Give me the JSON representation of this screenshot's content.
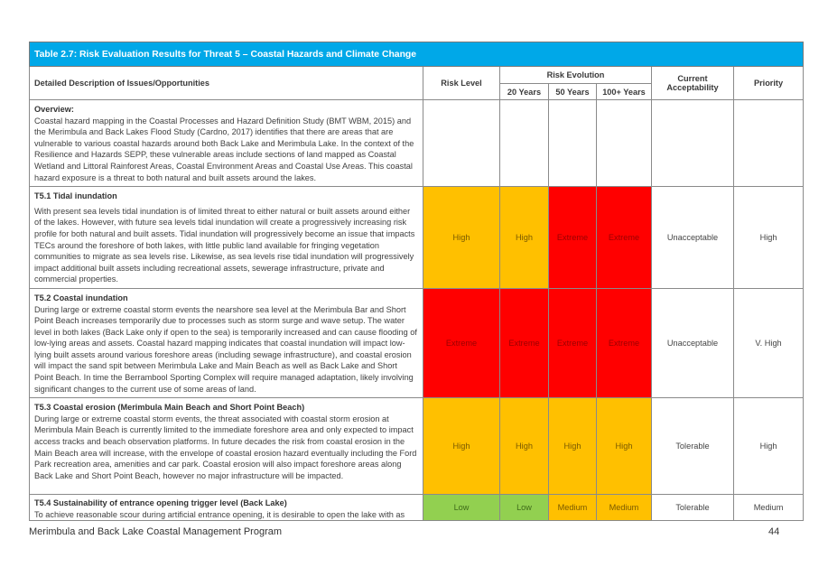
{
  "table": {
    "title": "Table 2.7: Risk Evaluation Results for Threat 5 – Coastal Hazards and Climate Change",
    "headers": {
      "description": "Detailed Description of Issues/Opportunities",
      "risk_level": "Risk Level",
      "risk_evolution": "Risk Evolution",
      "years_20": "20 Years",
      "years_50": "50 Years",
      "years_100": "100+ Years",
      "current_acceptability": "Current Acceptability",
      "priority": "Priority"
    },
    "overview": {
      "heading": "Overview:",
      "text": "Coastal hazard mapping in the Coastal Processes and Hazard Definition Study (BMT WBM, 2015) and the Merimbula and Back Lakes Flood Study (Cardno, 2017) identifies that there are areas that are vulnerable to various coastal hazards around both Back Lake and Merimbula Lake. In the context of the Resilience and Hazards SEPP, these vulnerable areas include sections of land mapped as Coastal Wetland and Littoral Rainforest Areas, Coastal Environment Areas and Coastal Use Areas. This coastal hazard exposure is a threat to both natural and built assets around the lakes."
    },
    "rows": [
      {
        "heading": "T5.1 Tidal inundation",
        "text": "With present sea levels tidal inundation is of limited threat to either natural or built assets around either of the lakes. However, with future sea levels tidal inundation will create a progressively increasing risk profile for both natural and built assets. Tidal inundation will progressively become an issue that impacts TECs around the foreshore of both lakes, with little public land available for fringing vegetation communities to migrate as sea levels rise. Likewise, as sea levels rise tidal inundation will progressively impact additional built assets including recreational assets, sewerage infrastructure, private and commercial properties.",
        "risk_level": "High",
        "y20": "High",
        "y50": "Extreme",
        "y100": "Extreme",
        "acceptability": "Unacceptable",
        "priority": "High"
      },
      {
        "heading": "T5.2 Coastal inundation",
        "text": "During large or extreme coastal storm events the nearshore sea level at the Merimbula Bar and Short Point Beach increases temporarily due to processes such as storm surge and wave setup. The water level in both lakes (Back Lake only if open to the sea) is temporarily increased and can cause flooding of low-lying areas and assets. Coastal hazard mapping indicates that coastal inundation will impact low-lying built assets around various foreshore areas (including sewage infrastructure), and coastal erosion will impact the sand spit between Merimbula Lake and Main Beach as well as Back Lake and Short Point Beach. In time the Berrambool Sporting Complex will require managed adaptation, likely involving significant changes to the current use of some areas of land.",
        "risk_level": "Extreme",
        "y20": "Extreme",
        "y50": "Extreme",
        "y100": "Extreme",
        "acceptability": "Unacceptable",
        "priority": "V. High"
      },
      {
        "heading": "T5.3 Coastal erosion (Merimbula Main Beach and Short Point Beach)",
        "text": "During large or extreme coastal storm events, the threat associated with coastal storm erosion at Merimbula Main Beach is currently limited to the immediate foreshore area and only expected to impact access tracks and beach observation platforms.  In future decades the risk from coastal erosion in the Main Beach area will increase, with the envelope of coastal erosion hazard eventually including the Ford Park recreation area, amenities and car park. Coastal erosion will also impact foreshore areas along Back Lake and Short Point Beach, however no major infrastructure will be impacted.",
        "risk_level": "High",
        "y20": "High",
        "y50": "High",
        "y100": "High",
        "acceptability": "Tolerable",
        "priority": "High"
      },
      {
        "heading": "T5.4 Sustainability of entrance opening trigger level (Back Lake)",
        "text": "To achieve reasonable scour during artificial entrance opening, it is desirable to open the lake with as",
        "risk_level": "Low",
        "y20": "Low",
        "y50": "Medium",
        "y100": "Medium",
        "acceptability": "Tolerable",
        "priority": "Medium"
      }
    ]
  },
  "colors": {
    "title_bar": "#00a8e8",
    "high": "#ffc000",
    "extreme": "#ff0000",
    "medium": "#ffc000",
    "low": "#92d050"
  },
  "footer": {
    "document_title": "Merimbula and Back Lake Coastal Management Program",
    "page_number": "44"
  }
}
